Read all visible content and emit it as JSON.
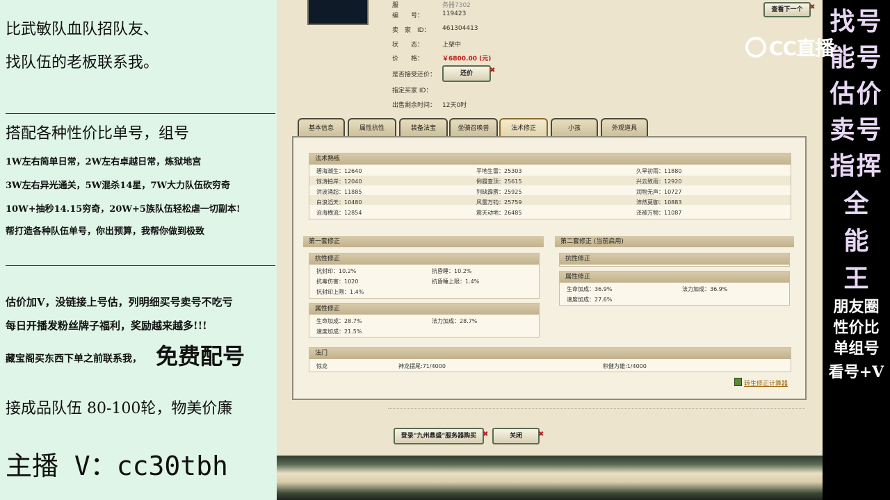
{
  "left_ads": {
    "line1": "比武敏队血队招队友、",
    "line2": "找队伍的老板联系我。",
    "line3": "搭配各种性价比单号，组号",
    "line4": "1W左右简单日常，2W左右卓越日常，炼狱地宫",
    "line5": "3W左右异光通关，5W混杀14星，7W大力队伍砍穷奇",
    "line6": "10W+抽秒14.15穷奇，20W+5族队伍轻松虐一切副本!",
    "line7": "帮打造各种队伍单号，你出预算，我帮你做到极致",
    "line8": "估价加V，没链接上号估，列明细买号卖号不吃亏",
    "line9": "每日开播发粉丝牌子福利，奖励越来越多!!!",
    "line10a": "藏宝阁买东西下单之前联系我，",
    "line10b": "免费配号",
    "line11": "接成品队伍 80-100轮，物美价廉",
    "line12": "主播 V：cc30tbh"
  },
  "right_ads": {
    "big_chars": [
      "找号",
      "能号",
      "估价",
      "卖号",
      "指挥",
      "全",
      "能",
      "王"
    ],
    "small_lines": [
      "朋友圈",
      "性价比",
      "单组号",
      "看号+V"
    ]
  },
  "overlay": {
    "logo_text": "CC直播"
  },
  "item": {
    "server_label": "服",
    "server_value": "务器7302",
    "id_label": "编　　号：",
    "id_value": "119423",
    "seller_label": "卖　家　ID：",
    "seller_value": "461304413",
    "status_label": "状　　态：",
    "status_value": "上架中",
    "price_label": "价　　格：",
    "price_value": "￥6800.00 (元)",
    "counter_label": "是否接受还价：",
    "counter_btn": "还价",
    "buyer_label": "指定买家 ID：",
    "time_label": "出售剩余时间：",
    "time_value": "12天0时",
    "next_btn": "查看下一个"
  },
  "tabs": [
    "基本信息",
    "属性抗性",
    "装备法宝",
    "坐骑召唤兽",
    "法术修正",
    "小孩",
    "外观道具"
  ],
  "active_tab": 4,
  "skills": {
    "title": "法术熟练",
    "rows": [
      [
        "碧海潮生：12640",
        "平地生雷：25303",
        "久旱初雨：11880"
      ],
      [
        "惊涛拍岸：12040",
        "倒履查顶：25615",
        "兴云致雨：12920"
      ],
      [
        "洪波涌起：11885",
        "列缺霹雳：25925",
        "润物无声：10727"
      ],
      [
        "白浪滔天：10480",
        "风雷万钧：25759",
        "沛然莫御：10883"
      ],
      [
        "沧海横流：12854",
        "震天动地：26485",
        "泽被万物：11087"
      ]
    ]
  },
  "set1": {
    "title": "第一套修正",
    "resist_title": "抗性修正",
    "resist": [
      "抗封印：10.2%",
      "抗昏睡：10.2%",
      "抗毒伤害：1020",
      "抗昏睡上限：1.4%",
      "抗封印上限：1.4%"
    ],
    "attr_title": "属性修正",
    "attr": [
      "生命加成：28.7%",
      "法力加成：28.7%",
      "速度加成：21.5%"
    ]
  },
  "set2": {
    "title": "第二套修正 (当前启用)",
    "resist_title": "抗性修正",
    "attr_title": "属性修正",
    "attr": [
      "生命加成：36.9%",
      "法力加成：36.9%",
      "速度加成：27.6%"
    ]
  },
  "fameng": {
    "title": "法门",
    "cells": [
      "惊龙",
      "神龙摆尾:71/4000",
      "积健为雄:1/4000"
    ]
  },
  "calc_link": "转生修正计算器",
  "bottom_buttons": {
    "login": "登录\"九州鼎盛\"服务器购买",
    "close": "关闭"
  }
}
